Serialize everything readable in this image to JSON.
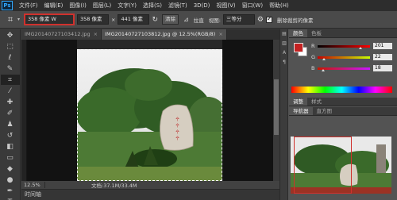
{
  "app": {
    "logo": "Ps"
  },
  "menu": [
    "文件(F)",
    "编辑(E)",
    "图像(I)",
    "图层(L)",
    "文字(Y)",
    "选择(S)",
    "滤镜(T)",
    "3D(D)",
    "视图(V)",
    "窗口(W)",
    "帮助(H)"
  ],
  "options": {
    "ratio_value": "358 像素 W",
    "width_value": "358 像素",
    "swap_symbol": "×",
    "height_value": "441 像素",
    "clear_label": "清除",
    "straighten_label": "拉直",
    "view_label": "视图:",
    "view_value": "三等分",
    "delete_cropped_label": "删除裁剪的像素"
  },
  "tabs": [
    {
      "label": "IMG20140727103412.jpg",
      "close": "×"
    },
    {
      "label": "IMG20140727103812.jpg @ 12.5%(RGB/8)",
      "close": "×"
    }
  ],
  "status": {
    "zoom": "12.5%",
    "doc": "文档:37.1M/33.4M"
  },
  "timeline_label": "时间轴",
  "color_panel": {
    "tabs": [
      "颜色",
      "色板"
    ],
    "fg_color": "#c42121",
    "channels": [
      {
        "label": "R",
        "value": "201",
        "pos": 0.79
      },
      {
        "label": "G",
        "value": "22",
        "pos": 0.09
      },
      {
        "label": "B",
        "value": "18",
        "pos": 0.07
      }
    ]
  },
  "adjust_tabs": [
    "调整",
    "样式"
  ],
  "navigator_tabs": [
    "导航器",
    "直方图"
  ]
}
